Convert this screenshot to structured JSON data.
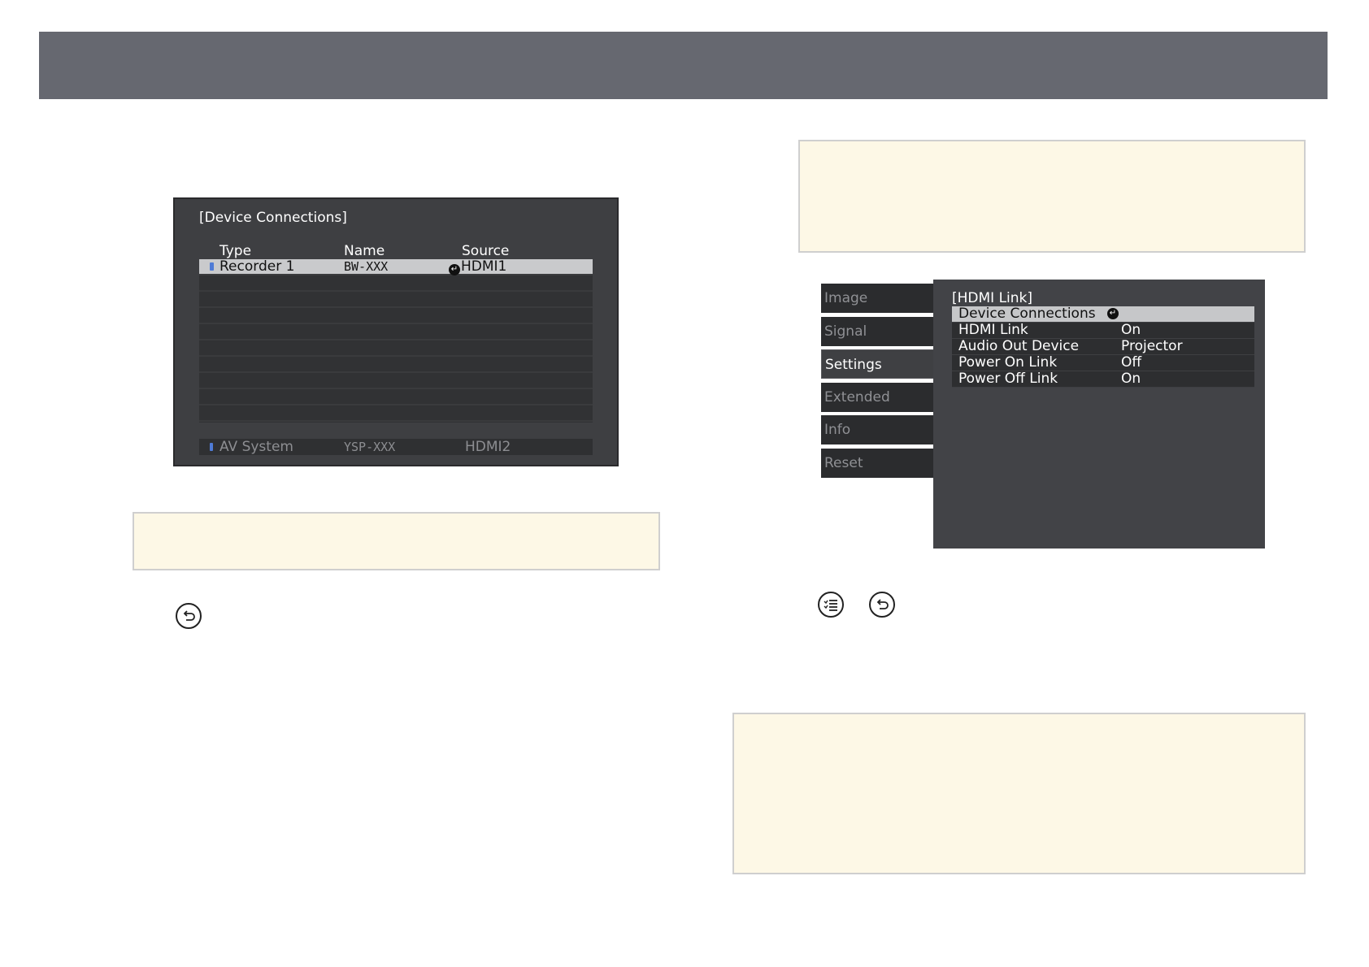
{
  "device_connections": {
    "title": "[Device Connections]",
    "columns": {
      "type": "Type",
      "name": "Name",
      "source": "Source"
    },
    "rows": [
      {
        "type": "Recorder 1",
        "name": "BW-XXX",
        "source": "HDMI1",
        "selected": true
      }
    ],
    "empty_row_count": 9,
    "footer": {
      "type": "AV System",
      "name": "YSP-XXX",
      "source": "HDMI2"
    }
  },
  "menu": {
    "tabs": [
      "Image",
      "Signal",
      "Settings",
      "Extended",
      "Info",
      "Reset"
    ],
    "active_tab": "Settings"
  },
  "hdmi_link": {
    "title": "[HDMI Link]",
    "items": [
      {
        "label": "Device Connections",
        "value": "",
        "selected": true
      },
      {
        "label": "HDMI Link",
        "value": "On"
      },
      {
        "label": "Audio Out Device",
        "value": "Projector"
      },
      {
        "label": "Power On Link",
        "value": "Off"
      },
      {
        "label": "Power Off Link",
        "value": "On"
      }
    ]
  },
  "buttons": {
    "left_esc_icon": "esc-return-icon",
    "right_menu_icon": "menu-list-icon",
    "right_esc_icon": "esc-return-icon"
  },
  "colors": {
    "header": "#666870",
    "note_fill": "#fdf8e6",
    "screen_bg": "#3e3f42",
    "selected_row": "#c9cacc",
    "device_marker": "#4f7bd6"
  }
}
